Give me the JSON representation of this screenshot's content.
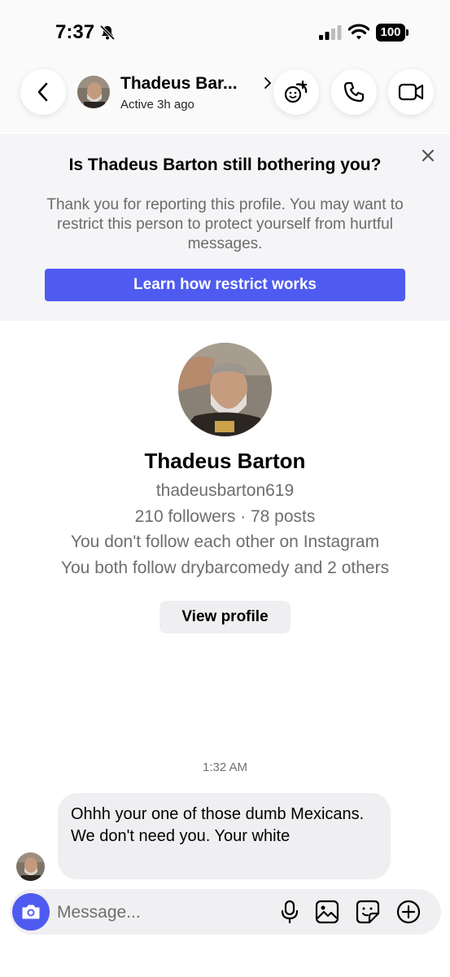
{
  "status_bar": {
    "time": "7:37",
    "battery": "100"
  },
  "header": {
    "contact_name": "Thadeus Bar...",
    "contact_status": "Active 3h ago"
  },
  "banner": {
    "title": "Is Thadeus Barton still bothering you?",
    "text": "Thank you for reporting this profile. You may want to restrict this person to protect yourself from hurtful messages.",
    "button": "Learn how restrict works"
  },
  "profile": {
    "name": "Thadeus Barton",
    "username": "thadeusbarton619",
    "stats": "210 followers · 78 posts",
    "follow_status": "You don't follow each other on Instagram",
    "mutual": "You both follow drybarcomedy and 2 others",
    "view_button": "View profile"
  },
  "chat": {
    "timestamp": "1:32 AM",
    "messages": [
      {
        "text": "Ohhh your one of those dumb Mexicans.  We don't need you. Your white"
      }
    ]
  },
  "composer": {
    "placeholder": "Message..."
  },
  "colors": {
    "accent": "#4f5bf0",
    "banner_bg": "#f5f5f7",
    "bubble_bg": "#efeff1"
  },
  "icons": [
    "bell-slash-icon",
    "signal-icon",
    "wifi-icon",
    "back-chevron-icon",
    "effects-icon",
    "phone-icon",
    "video-camera-icon",
    "close-icon",
    "camera-icon",
    "microphone-icon",
    "gallery-icon",
    "sticker-icon",
    "plus-icon"
  ]
}
